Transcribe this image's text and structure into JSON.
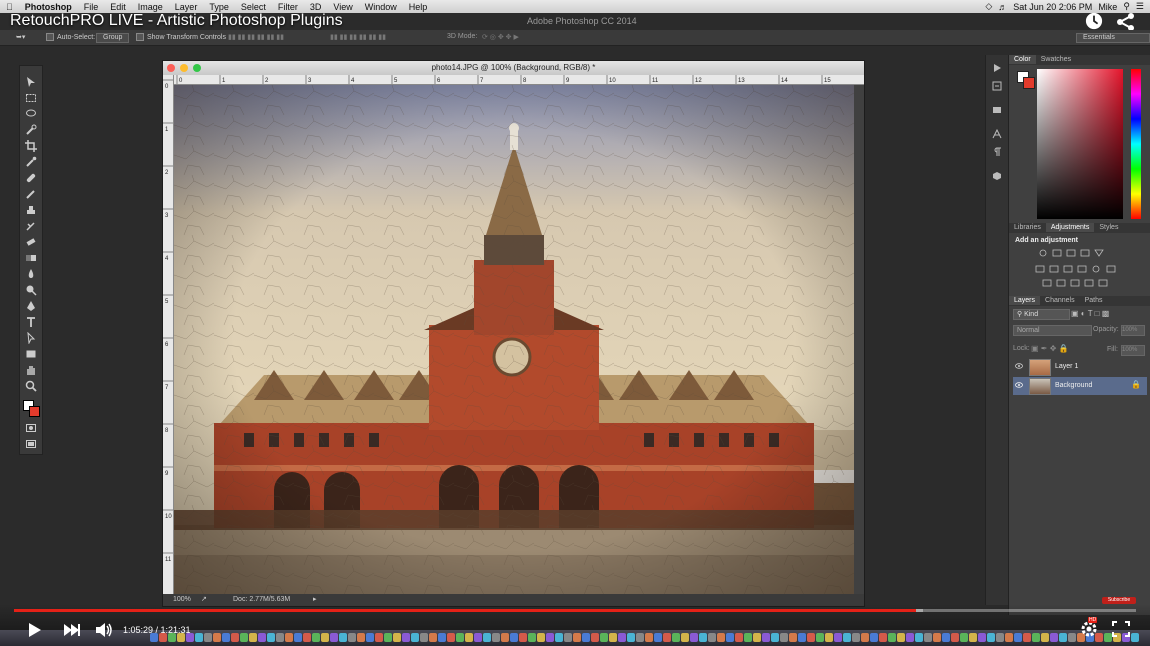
{
  "menubar": {
    "apple": "",
    "app_name": "Photoshop",
    "items": [
      "File",
      "Edit",
      "Image",
      "Layer",
      "Type",
      "Select",
      "Filter",
      "3D",
      "View",
      "Window",
      "Help"
    ],
    "datetime": "Sat Jun 20  2:06 PM",
    "user": "Mike"
  },
  "video": {
    "title": "RetouchPRO LIVE - Artistic Photoshop Plugins",
    "current_time": "1:05:29",
    "duration": "1:21:31",
    "time_display": "1:05:29 / 1:21:31",
    "progress": 0.804,
    "loaded": 0.81,
    "subscribe": "Subscribe",
    "accent": "#e52117"
  },
  "app": {
    "window_title": "Adobe Photoshop CC 2014",
    "workspace": "Essentials"
  },
  "options_bar": {
    "auto_select_label": "Auto-Select:",
    "auto_select_value": "Group",
    "transform_label": "Show Transform Controls",
    "mode_3d_label": "3D Mode:"
  },
  "document": {
    "title": "photo14.JPG @ 100% (Background, RGB/8) *",
    "zoom": "100%",
    "doc_size": "Doc: 2.77M/5.63M",
    "ruler_h": [
      "0",
      "1",
      "2",
      "3",
      "4",
      "5",
      "6",
      "7",
      "8",
      "9",
      "10",
      "11",
      "12",
      "13",
      "14",
      "15"
    ],
    "ruler_v": [
      "0",
      "1",
      "2",
      "3",
      "4",
      "5",
      "6",
      "7",
      "8",
      "9",
      "10",
      "11"
    ]
  },
  "panels": {
    "color_tabs": [
      "Color",
      "Swatches"
    ],
    "adjust_tabs": [
      "Libraries",
      "Adjustments",
      "Styles"
    ],
    "add_adjustment": "Add an adjustment",
    "layer_tabs": [
      "Layers",
      "Channels",
      "Paths"
    ],
    "kind": "Kind",
    "blend_mode": "Normal",
    "opacity_label": "Opacity:",
    "opacity_value": "100%",
    "lock_label": "Lock:",
    "fill_label": "Fill:",
    "fill_value": "100%",
    "layers": [
      {
        "name": "Layer 1",
        "selected": false
      },
      {
        "name": "Background",
        "selected": true
      }
    ]
  }
}
